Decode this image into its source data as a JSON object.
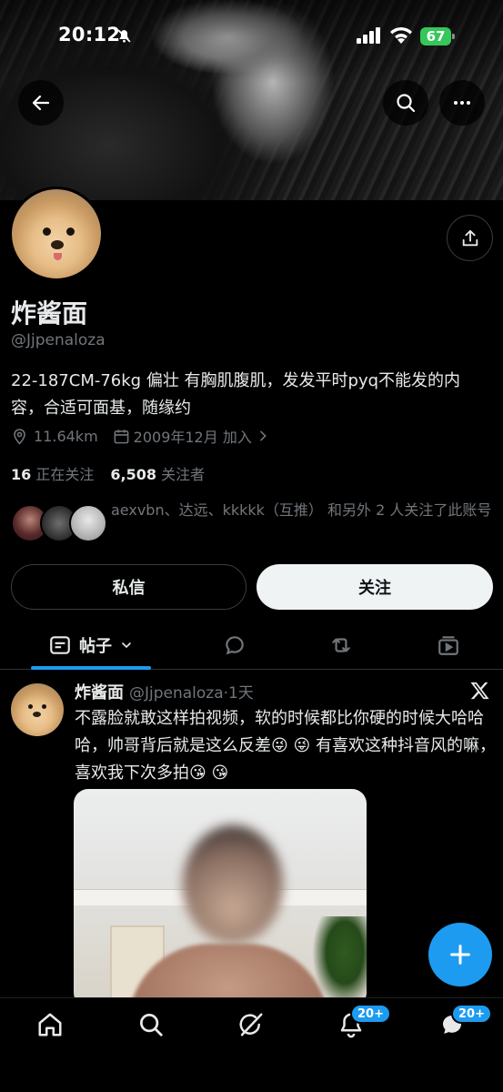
{
  "status_bar": {
    "time": "20:12",
    "battery": "67"
  },
  "profile": {
    "name": "炸酱面",
    "handle": "@Jjpenaloza",
    "bio": "22-187CM-76kg 偏壮 有胸肌腹肌，发发平时pyq不能发的内容，合适可面基，随缘约",
    "location": "11.64km",
    "joined": "2009年12月 加入",
    "following_count": "16",
    "following_label": "正在关注",
    "followers_count": "6,508",
    "followers_label": "关注者",
    "followed_by_text": "aexvbn、达远、kkkkk（互推） 和另外 2 人关注了此账号"
  },
  "actions": {
    "message_label": "私信",
    "follow_label": "关注"
  },
  "tabs": {
    "posts_label": "帖子"
  },
  "post": {
    "author": "炸酱面",
    "handle": "@Jjpenaloza",
    "time": "·1天",
    "text": "不露脸就敢这样拍视频，软的时候都比你硬的时候大哈哈哈，帅哥背后就是这么反差😜 😜 有喜欢这种抖音风的嘛，喜欢我下次多拍😘 😘"
  },
  "bottom_nav": {
    "notifications_badge": "20+",
    "messages_badge": "20+"
  },
  "colors": {
    "accent": "#1d9bf0",
    "background": "#000000",
    "secondary_text": "#71767b",
    "battery": "#35c759"
  },
  "icons": [
    "back-arrow-icon",
    "search-icon",
    "more-icon",
    "share-icon",
    "location-icon",
    "calendar-icon",
    "chevron-right-icon",
    "posts-icon",
    "chevron-down-icon",
    "reply-icon",
    "repost-icon",
    "media-icon",
    "x-logo-icon",
    "plus-icon",
    "home-icon",
    "grok-icon",
    "bell-icon",
    "messages-icon"
  ]
}
